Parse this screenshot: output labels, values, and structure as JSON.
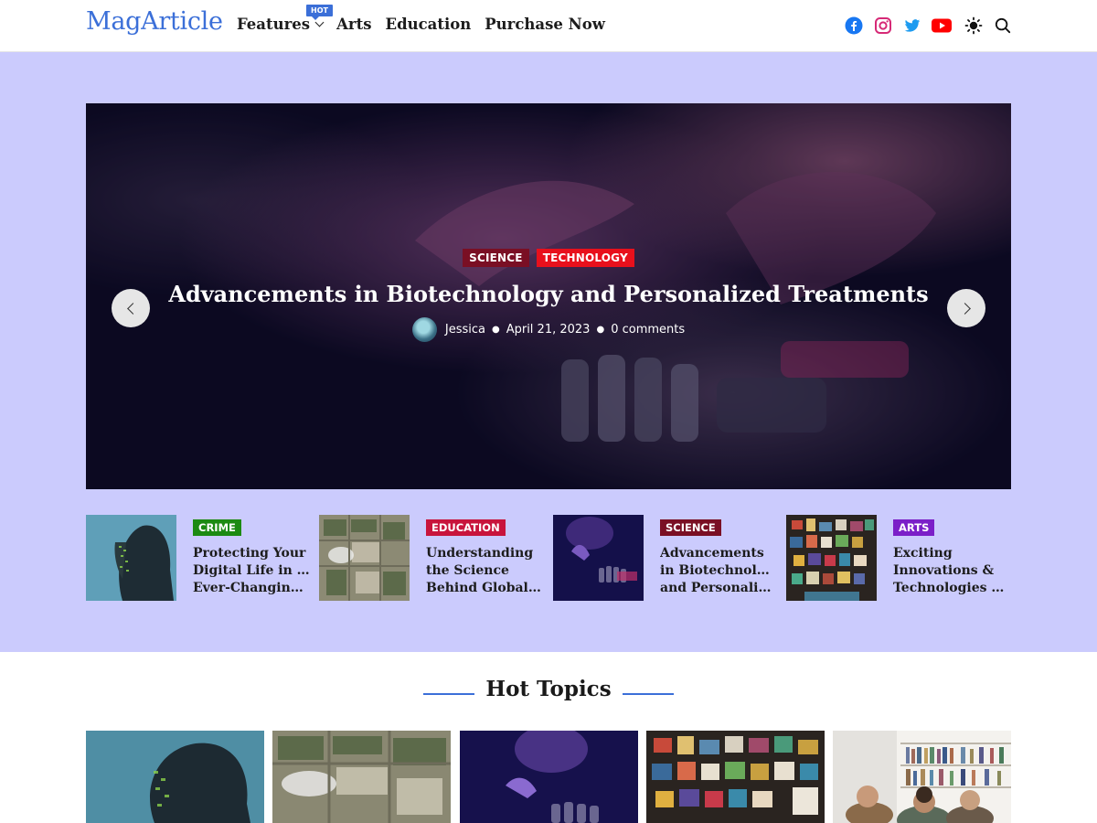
{
  "header": {
    "logo": "MagArticle",
    "nav": [
      {
        "label": "Features",
        "badge": "HOT",
        "has_dropdown": true
      },
      {
        "label": "Arts"
      },
      {
        "label": "Education"
      },
      {
        "label": "Purchase Now"
      }
    ],
    "icons": [
      "facebook-icon",
      "instagram-icon",
      "twitter-icon",
      "youtube-icon",
      "theme-toggle-icon",
      "search-icon"
    ]
  },
  "colors": {
    "brand": "#3b6fd8",
    "band": "#cbcbfd",
    "science": "#7a0f24",
    "technology": "#e8101c",
    "crime": "#1c8a12",
    "education": "#c8143c",
    "arts": "#7b1fc8"
  },
  "hero": {
    "categories": [
      "SCIENCE",
      "TECHNOLOGY"
    ],
    "title": "Advancements in Biotechnology and Personalized Treatments",
    "author": "Jessica",
    "date": "April 21, 2023",
    "comments": "0 comments"
  },
  "thumbs": [
    {
      "category": "CRIME",
      "title_lines": [
        "Protecting Your",
        "Digital Life in an",
        "Ever-Changing…"
      ]
    },
    {
      "category": "EDUCATION",
      "title_lines": [
        "Understanding",
        "the Science",
        "Behind Global…"
      ]
    },
    {
      "category": "SCIENCE",
      "title_lines": [
        "Advancements",
        "in Biotechnology",
        "and Personalize…"
      ]
    },
    {
      "category": "ARTS",
      "title_lines": [
        "Exciting",
        "Innovations &",
        "Technologies o…"
      ]
    }
  ],
  "hot_topics": {
    "heading": "Hot Topics"
  }
}
